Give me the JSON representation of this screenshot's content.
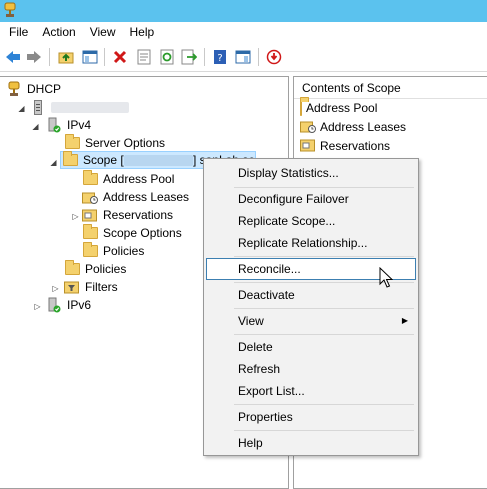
{
  "menubar": {
    "items": [
      "File",
      "Action",
      "View",
      "Help"
    ]
  },
  "toolbar": {
    "buttons": [
      "back-icon",
      "forward-icon",
      "up-folder-icon",
      "show-hide-tree-icon",
      "delete-icon",
      "properties-icon",
      "refresh-icon",
      "export-list-icon",
      "help-icon",
      "show-action-pane-icon",
      "stop-icon"
    ]
  },
  "tree": {
    "root": "DHCP",
    "server": "",
    "ipv4": "IPv4",
    "server_options": "Server Options",
    "scope_prefix": "Scope [",
    "scope_suffix": "] sanLab.se",
    "address_pool": "Address Pool",
    "address_leases": "Address Leases",
    "reservations": "Reservations",
    "scope_options": "Scope Options",
    "scope_policies": "Policies",
    "policies": "Policies",
    "filters": "Filters",
    "ipv6": "IPv6"
  },
  "right_pane": {
    "header": "Contents of Scope",
    "items": [
      "Address Pool",
      "Address Leases",
      "Reservations"
    ]
  },
  "context_menu": {
    "items": [
      {
        "label": "Display Statistics..."
      },
      {
        "label": "Deconfigure Failover"
      },
      {
        "label": "Replicate Scope..."
      },
      {
        "label": "Replicate Relationship..."
      },
      {
        "label": "Reconcile..."
      },
      {
        "label": "Deactivate"
      },
      {
        "label": "View"
      },
      {
        "label": "Delete"
      },
      {
        "label": "Refresh"
      },
      {
        "label": "Export List..."
      },
      {
        "label": "Properties"
      },
      {
        "label": "Help"
      }
    ],
    "highlighted": "Reconcile..."
  },
  "colors": {
    "titlebar": "#5bc2ee",
    "selection": "#cce8ff",
    "menu_highlight_border": "#3c7fb1"
  }
}
